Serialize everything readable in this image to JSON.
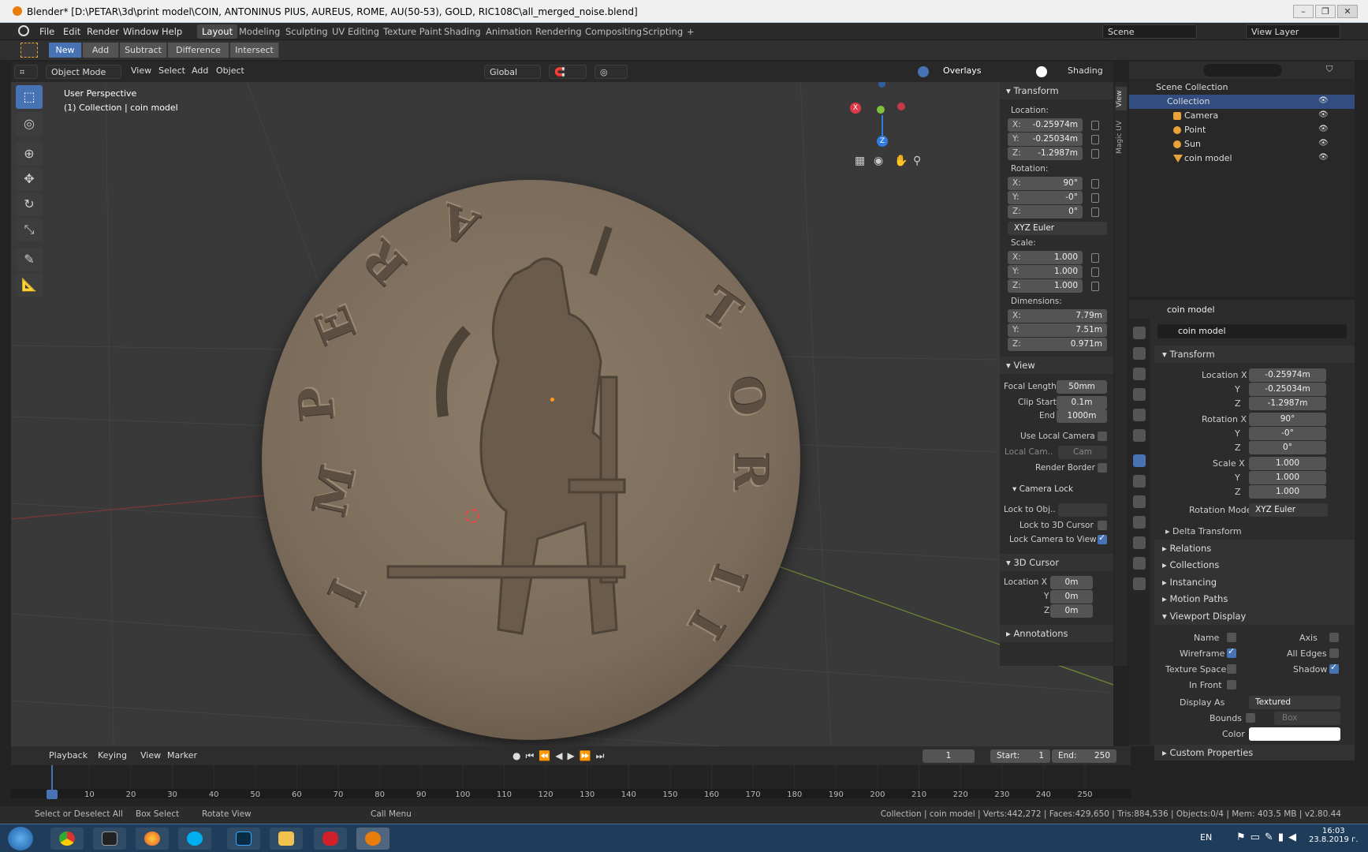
{
  "window": {
    "title": "Blender* [D:\\PETAR\\3d\\print model\\COIN, ANTONINUS PIUS, AUREUS, ROME, AU(50-53), GOLD, RIC108C\\all_merged_noise.blend]"
  },
  "menu": [
    "File",
    "Edit",
    "Render",
    "Window",
    "Help"
  ],
  "workspaces": [
    "Layout",
    "Modeling",
    "Sculpting",
    "UV Editing",
    "Texture Paint",
    "Shading",
    "Animation",
    "Rendering",
    "Compositing",
    "Scripting"
  ],
  "workspace_add": "+",
  "scene": {
    "scene_name": "Scene",
    "view_layer": "View Layer"
  },
  "boolean_tools": [
    "New",
    "Add",
    "Subtract",
    "Difference",
    "Intersect"
  ],
  "viewport_header": {
    "mode": "Object Mode",
    "menus": [
      "View",
      "Select",
      "Add",
      "Object"
    ],
    "orientation": "Global",
    "overlays": "Overlays",
    "shading": "Shading"
  },
  "viewport_info": {
    "perspective": "User Perspective",
    "collection": "(1) Collection | coin model"
  },
  "coin_letters": [
    "I",
    "M",
    "P",
    "E",
    "R",
    "A",
    "T",
    "O",
    "R",
    "I",
    "I"
  ],
  "npanel": {
    "transform": "Transform",
    "location_label": "Location:",
    "location": {
      "x": "-0.25974m",
      "y": "-0.25034m",
      "z": "-1.2987m"
    },
    "rotation_label": "Rotation:",
    "rotation": {
      "x": "90°",
      "y": "-0°",
      "z": "0°"
    },
    "rotation_mode": "XYZ Euler",
    "scale_label": "Scale:",
    "scale": {
      "x": "1.000",
      "y": "1.000",
      "z": "1.000"
    },
    "dimensions_label": "Dimensions:",
    "dimensions": {
      "x": "7.79m",
      "y": "7.51m",
      "z": "0.971m"
    },
    "axis_x": "X:",
    "axis_y": "Y:",
    "axis_z": "Z:",
    "view": "View",
    "focal_length_label": "Focal Length",
    "focal_length": "50mm",
    "clip_start_label": "Clip Start",
    "clip_start": "0.1m",
    "end_label": "End",
    "end": "1000m",
    "use_local_camera": "Use Local Camera",
    "local_camera_label": "Local Cam..",
    "local_camera": "Cam",
    "render_border": "Render Border",
    "camera_lock": "Camera Lock",
    "lock_to_obj": "Lock to Obj..",
    "lock_to_3d_cursor": "Lock to 3D Cursor",
    "lock_camera_to_view": "Lock Camera to View",
    "cursor": "3D Cursor",
    "cursor_location_label": "Location X",
    "cursor_y_label": "Y",
    "cursor_z_label": "Z",
    "cursor_location": {
      "x": "0m",
      "y": "0m",
      "z": "0m"
    },
    "annotations": "Annotations"
  },
  "side_tabs": [
    "View",
    "Magic UV"
  ],
  "outliner": {
    "root": "Scene Collection",
    "collection": "Collection",
    "items": [
      "Camera",
      "Point",
      "Sun",
      "coin model"
    ]
  },
  "properties": {
    "object_name": "coin model",
    "data_name": "coin model",
    "transform": "Transform",
    "location_x_label": "Location X",
    "y_label": "Y",
    "z_label": "Z",
    "location": {
      "x": "-0.25974m",
      "y": "-0.25034m",
      "z": "-1.2987m"
    },
    "rotation_x_label": "Rotation X",
    "rotation": {
      "x": "90°",
      "y": "-0°",
      "z": "0°"
    },
    "scale_x_label": "Scale X",
    "scale": {
      "x": "1.000",
      "y": "1.000",
      "z": "1.000"
    },
    "rotation_mode_label": "Rotation Mode",
    "rotation_mode": "XYZ Euler",
    "delta_transform": "Delta Transform",
    "relations": "Relations",
    "collections": "Collections",
    "instancing": "Instancing",
    "motion_paths": "Motion Paths",
    "viewport_display": "Viewport Display",
    "name_label": "Name",
    "axis_label": "Axis",
    "wireframe_label": "Wireframe",
    "all_edges_label": "All Edges",
    "texture_space_label": "Texture Space",
    "shadow_label": "Shadow",
    "in_front_label": "In Front",
    "display_as_label": "Display As",
    "display_as": "Textured",
    "bounds_label": "Bounds",
    "bounds": "Box",
    "color_label": "Color",
    "custom_properties": "Custom Properties"
  },
  "timeline": {
    "menus": [
      "Playback",
      "Keying",
      "View",
      "Marker"
    ],
    "current_frame": "1",
    "start_label": "Start:",
    "start": "1",
    "end_label": "End:",
    "end": "250",
    "ruler": [
      "1",
      "10",
      "20",
      "30",
      "40",
      "50",
      "60",
      "70",
      "80",
      "90",
      "100",
      "110",
      "120",
      "130",
      "140",
      "150",
      "160",
      "170",
      "180",
      "190",
      "200",
      "210",
      "220",
      "230",
      "240",
      "250"
    ]
  },
  "status": {
    "select": "Select or Deselect All",
    "box_select": "Box Select",
    "rotate_view": "Rotate View",
    "call_menu": "Call Menu",
    "stats": "Collection | coin model | Verts:442,272 | Faces:429,650 | Tris:884,536 | Objects:0/4 | Mem: 403.5 MB | v2.80.44"
  },
  "tray": {
    "lang": "EN",
    "time": "16:03",
    "date": "23.8.2019 г."
  },
  "colors": {
    "accent": "#4772b3",
    "coin": "#7b6b5a",
    "x_axis": "#e03a4a",
    "y_axis": "#7ec23b",
    "z_axis": "#2f7de1"
  }
}
